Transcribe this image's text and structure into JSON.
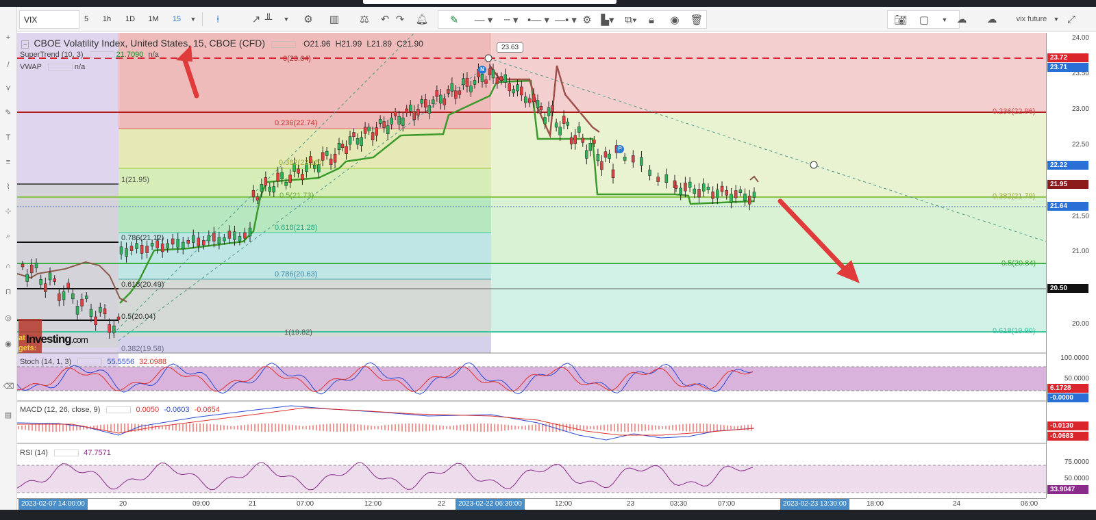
{
  "toolbar": {
    "symbol": "VIX",
    "intervals": [
      "5",
      "1h",
      "1D",
      "1M",
      "15"
    ],
    "active_interval": "15",
    "layout_name": "vix future"
  },
  "legend": {
    "title": "CBOE Volatility Index, United States, 15, CBOE (CFD)",
    "open": "O21.96",
    "high": "H21.99",
    "low": "L21.89",
    "close": "C21.90",
    "supertrend_label": "SuperTrend (10, 3)",
    "supertrend_value": "21.7090",
    "supertrend_na": "n/a",
    "vwap_label": "VWAP",
    "vwap_value": "n/a",
    "stoch_label": "Stoch (14, 1, 3)",
    "stoch_k": "55.5556",
    "stoch_d": "32.0988",
    "macd_label": "MACD (12, 26, close, 9)",
    "macd_v1": "0.0050",
    "macd_v2": "-0.0603",
    "macd_v3": "-0.0654",
    "rsi_label": "RSI (14)",
    "rsi_value": "47.7571"
  },
  "callout": "23.63",
  "fib_left": {
    "l0": "0(23.64)",
    "l236": "0.236(22.74)",
    "l382": "0.382(22.18)",
    "l5": "0.5(21.73)",
    "l618": "0.618(21.28)",
    "l786": "0.786(20.63)",
    "l1": "1(19.82)"
  },
  "fib_far": {
    "l1": "1(21.95)",
    "l786": "0.786(21.12)",
    "l618": "0.618(20.49)",
    "l5": "0.5(20.04)",
    "l382": "0.382(19.58)"
  },
  "fib_right": {
    "l236": "0.236(22.96)",
    "l382": "0.382(21.79)",
    "l5": "0.5(20.84)",
    "l618": "0.618(19.90)"
  },
  "logo": "Investing",
  "logo_suffix": ".com",
  "overlay_text": [
    "at",
    "gets:"
  ],
  "price_axis": {
    "ticks": [
      "24.00",
      "23.50",
      "23.00",
      "22.50",
      "21.50",
      "21.00",
      "20.00"
    ],
    "labels": [
      {
        "text": "23.72",
        "color": "#d9252b"
      },
      {
        "text": "23.71",
        "color": "#2a6fd6"
      },
      {
        "text": "22.22",
        "color": "#2a6fd6"
      },
      {
        "text": "21.95",
        "color": "#8b1a1a"
      },
      {
        "text": "21.64",
        "color": "#2a6fd6"
      },
      {
        "text": "20.50",
        "color": "#111111"
      }
    ],
    "stoch_ticks": [
      "100.0000",
      "50.0000"
    ],
    "stoch_labels": [
      {
        "text": "6.1728",
        "color": "#d9252b"
      },
      {
        "text": "-0.0000",
        "color": "#2a6fd6"
      }
    ],
    "macd_labels": [
      {
        "text": "-0.0130",
        "color": "#d9252b"
      },
      {
        "text": "-0.0683",
        "color": "#d9252b"
      }
    ],
    "rsi_ticks": [
      "75.0000",
      "50.0000"
    ],
    "rsi_label": {
      "text": "33.9047",
      "color": "#8a2a8a"
    }
  },
  "time_axis": {
    "labels": [
      "20",
      "09:00",
      "21",
      "07:00",
      "12:00",
      "22",
      "12:00",
      "23",
      "03:30",
      "07:00",
      "18:00",
      "24",
      "06:00"
    ],
    "highlights": [
      "2023-02-07 14:00:00",
      "2023-02-22 06:30:00",
      "2023-02-23 13:30:00"
    ]
  }
}
